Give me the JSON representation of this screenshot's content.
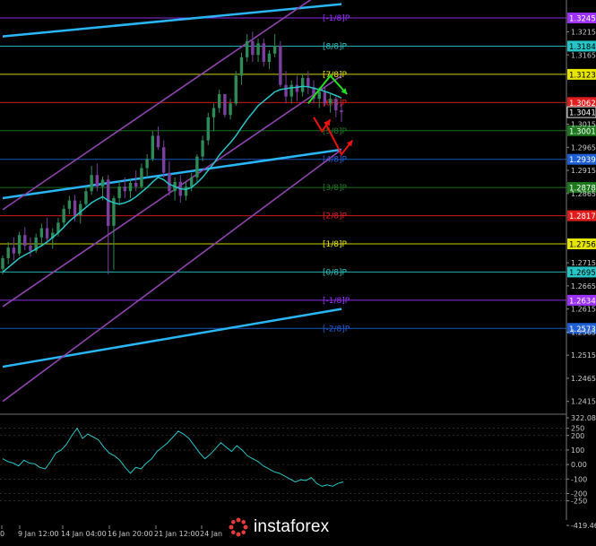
{
  "chart_data": [
    {
      "type": "candlestick",
      "title": "",
      "ylim": [
        1.2395,
        1.328
      ],
      "x_ticks": [
        "0",
        "9 Jan 12:00",
        "14 Jan 04:00",
        "16 Jan 20:00",
        "21 Jan 12:00",
        "24 Jan"
      ],
      "y_ticks": [
        1.3215,
        1.3165,
        1.3015,
        1.2965,
        1.2915,
        1.2865,
        1.2715,
        1.2665,
        1.2615,
        1.2565,
        1.2515,
        1.2465,
        1.2415
      ],
      "current_price": "1.3041",
      "murrey_levels": [
        {
          "label": "[-1/8]P",
          "price": 1.3245,
          "price_label": "1.3245",
          "color": "#9b30ff"
        },
        {
          "label": "[8/8]P",
          "price": 1.3184,
          "price_label": "1.3184",
          "color": "#26c6c6"
        },
        {
          "label": "[7/8]P",
          "price": 1.3123,
          "price_label": "1.3123",
          "color": "#e5e500"
        },
        {
          "label": "[6/8]P",
          "price": 1.3062,
          "price_label": "1.3062",
          "color": "#e11d1d"
        },
        {
          "label": "[5/8]P",
          "price": 1.3001,
          "price_label": "1.3001",
          "color": "#1c7a1c"
        },
        {
          "label": "[4/8]P",
          "price": 1.2939,
          "price_label": "1.2939",
          "color": "#1f5fd6"
        },
        {
          "label": "[3/8]P",
          "price": 1.2878,
          "price_label": "1.2878",
          "color": "#1c7a1c"
        },
        {
          "label": "[2/8]P",
          "price": 1.2817,
          "price_label": "1.2817",
          "color": "#e11d1d"
        },
        {
          "label": "[1/8]P",
          "price": 1.2756,
          "price_label": "1.2756",
          "color": "#e5e500"
        },
        {
          "label": "[0/8]P",
          "price": 1.2695,
          "price_label": "1.2695",
          "color": "#26c6c6"
        },
        {
          "label": "[-1/8]P",
          "price": 1.2634,
          "price_label": "1.2634",
          "color": "#9b30ff"
        },
        {
          "label": "[-2/8]P",
          "price": 1.2573,
          "price_label": "1.2573",
          "color": "#1f5fd6"
        }
      ],
      "candles": [
        [
          1.2702,
          1.2731,
          1.269,
          1.2725
        ],
        [
          1.2725,
          1.276,
          1.2712,
          1.2748
        ],
        [
          1.2748,
          1.277,
          1.272,
          1.2735
        ],
        [
          1.2735,
          1.2782,
          1.273,
          1.2775
        ],
        [
          1.2775,
          1.2792,
          1.2742,
          1.2752
        ],
        [
          1.2752,
          1.277,
          1.2728,
          1.2741
        ],
        [
          1.2741,
          1.2778,
          1.2736,
          1.277
        ],
        [
          1.277,
          1.28,
          1.2752,
          1.279
        ],
        [
          1.279,
          1.2812,
          1.276,
          1.2768
        ],
        [
          1.2768,
          1.279,
          1.2745,
          1.278
        ],
        [
          1.278,
          1.2812,
          1.2772,
          1.2802
        ],
        [
          1.2802,
          1.284,
          1.2795,
          1.2832
        ],
        [
          1.2832,
          1.286,
          1.282,
          1.285
        ],
        [
          1.285,
          1.2862,
          1.2805,
          1.2818
        ],
        [
          1.2818,
          1.285,
          1.28,
          1.2842
        ],
        [
          1.2842,
          1.288,
          1.2838,
          1.287
        ],
        [
          1.287,
          1.2925,
          1.2862,
          1.2905
        ],
        [
          1.2905,
          1.293,
          1.287,
          1.288
        ],
        [
          1.288,
          1.2902,
          1.285,
          1.2895
        ],
        [
          1.2895,
          1.2905,
          1.269,
          1.2795
        ],
        [
          1.2795,
          1.286,
          1.27,
          1.2855
        ],
        [
          1.2855,
          1.2892,
          1.284,
          1.288
        ],
        [
          1.288,
          1.29,
          1.2855,
          1.287
        ],
        [
          1.287,
          1.2895,
          1.2855,
          1.2888
        ],
        [
          1.2888,
          1.2915,
          1.287,
          1.288
        ],
        [
          1.288,
          1.293,
          1.2875,
          1.292
        ],
        [
          1.292,
          1.295,
          1.29,
          1.294
        ],
        [
          1.294,
          1.3,
          1.2935,
          1.299
        ],
        [
          1.299,
          1.301,
          1.296,
          1.2965
        ],
        [
          1.2965,
          1.298,
          1.29,
          1.291
        ],
        [
          1.291,
          1.2935,
          1.286,
          1.287
        ],
        [
          1.287,
          1.29,
          1.285,
          1.289
        ],
        [
          1.289,
          1.2905,
          1.2845,
          1.286
        ],
        [
          1.286,
          1.289,
          1.285,
          1.288
        ],
        [
          1.288,
          1.291,
          1.287,
          1.29
        ],
        [
          1.29,
          1.295,
          1.289,
          1.2945
        ],
        [
          1.2945,
          1.299,
          1.2935,
          1.298
        ],
        [
          1.298,
          1.304,
          1.297,
          1.303
        ],
        [
          1.303,
          1.306,
          1.3,
          1.305
        ],
        [
          1.305,
          1.309,
          1.304,
          1.308
        ],
        [
          1.308,
          1.306,
          1.303,
          1.3035
        ],
        [
          1.3035,
          1.307,
          1.3025,
          1.306
        ],
        [
          1.306,
          1.313,
          1.3055,
          1.312
        ],
        [
          1.312,
          1.317,
          1.31,
          1.316
        ],
        [
          1.316,
          1.321,
          1.315,
          1.3195
        ],
        [
          1.3195,
          1.3215,
          1.315,
          1.3165
        ],
        [
          1.3165,
          1.32,
          1.315,
          1.319
        ],
        [
          1.319,
          1.32,
          1.314,
          1.315
        ],
        [
          1.315,
          1.3175,
          1.3135,
          1.3168
        ],
        [
          1.3168,
          1.321,
          1.316,
          1.3185
        ],
        [
          1.3185,
          1.3195,
          1.3095,
          1.31
        ],
        [
          1.31,
          1.313,
          1.306,
          1.3075
        ],
        [
          1.3075,
          1.311,
          1.306,
          1.31
        ],
        [
          1.31,
          1.312,
          1.3065,
          1.3085
        ],
        [
          1.3085,
          1.3125,
          1.3075,
          1.3115
        ],
        [
          1.3115,
          1.313,
          1.308,
          1.3095
        ],
        [
          1.3095,
          1.311,
          1.306,
          1.307
        ],
        [
          1.307,
          1.3095,
          1.305,
          1.3085
        ],
        [
          1.3085,
          1.3095,
          1.3055,
          1.306
        ],
        [
          1.306,
          1.308,
          1.304,
          1.307
        ],
        [
          1.307,
          1.3075,
          1.303,
          1.3045
        ],
        [
          1.3045,
          1.306,
          1.302,
          1.3041
        ]
      ],
      "sma": [
        1.2695,
        1.2705,
        1.2715,
        1.2725,
        1.2732,
        1.2738,
        1.2745,
        1.2752,
        1.276,
        1.277,
        1.278,
        1.2792,
        1.2805,
        1.2815,
        1.2825,
        1.2835,
        1.2845,
        1.2852,
        1.2858,
        1.285,
        1.2845,
        1.2842,
        1.2845,
        1.285,
        1.2858,
        1.2868,
        1.2878,
        1.289,
        1.29,
        1.2895,
        1.2885,
        1.288,
        1.2875,
        1.2874,
        1.2878,
        1.2888,
        1.29,
        1.2915,
        1.293,
        1.2948,
        1.2962,
        1.2975,
        1.299,
        1.3008,
        1.3025,
        1.304,
        1.3055,
        1.3065,
        1.3075,
        1.3085,
        1.309,
        1.3092,
        1.3094,
        1.3095,
        1.3097,
        1.3096,
        1.3093,
        1.309,
        1.3086,
        1.3082,
        1.3077,
        1.3072
      ],
      "channels": [
        {
          "name": "upper-blue",
          "color": "#29b6f6",
          "p0": [
            0,
            1.3205
          ],
          "p1": [
            61,
            1.3275
          ]
        },
        {
          "name": "mid-blue",
          "color": "#29b6f6",
          "p0": [
            0,
            1.2855
          ],
          "p1": [
            61,
            1.296
          ]
        },
        {
          "name": "lower-blue",
          "color": "#29b6f6",
          "p0": [
            0,
            1.249
          ],
          "p1": [
            61,
            1.2615
          ]
        },
        {
          "name": "purple-top",
          "color": "#8e44ad",
          "p0": [
            0,
            1.283
          ],
          "p1": [
            61,
            1.333
          ]
        },
        {
          "name": "purple-mid",
          "color": "#8e44ad",
          "p0": [
            0,
            1.262
          ],
          "p1": [
            61,
            1.312
          ]
        },
        {
          "name": "purple-bottom",
          "color": "#8e44ad",
          "p0": [
            0,
            1.2415
          ],
          "p1": [
            61,
            1.296
          ]
        }
      ],
      "arrows": [
        {
          "color": "#22dd22",
          "points": [
            [
              55,
              1.306
            ],
            [
              59,
              1.312
            ],
            [
              62,
              1.308
            ]
          ]
        },
        {
          "color": "#ee1111",
          "points": [
            [
              56,
              1.303
            ],
            [
              57.5,
              1.3
            ],
            [
              59,
              1.3025
            ]
          ]
        },
        {
          "color": "#ee1111",
          "points": [
            [
              58,
              1.302
            ],
            [
              61,
              1.295
            ],
            [
              63,
              1.298
            ]
          ]
        }
      ]
    },
    {
      "type": "line",
      "title": "",
      "ylim": [
        -419.46,
        322.0898
      ],
      "y_ticks": [
        "322.0898",
        "250",
        "200",
        "100",
        "0.00",
        "-100",
        "-200",
        "-250",
        "-419.4600"
      ],
      "series": [
        {
          "color": "#26c6c6",
          "values": [
            40,
            20,
            10,
            -10,
            30,
            10,
            5,
            -20,
            -30,
            20,
            80,
            100,
            140,
            200,
            250,
            180,
            210,
            190,
            170,
            120,
            80,
            60,
            30,
            -20,
            -60,
            -20,
            -30,
            10,
            40,
            90,
            120,
            150,
            190,
            230,
            210,
            180,
            130,
            80,
            40,
            70,
            110,
            150,
            120,
            90,
            130,
            100,
            60,
            40,
            20,
            -10,
            -30,
            -50,
            -60,
            -80,
            -100,
            -120,
            -105,
            -110,
            -90,
            -130,
            -150,
            -140,
            -150,
            -130,
            -120
          ]
        }
      ]
    }
  ],
  "logo": {
    "text": "instaforex"
  }
}
